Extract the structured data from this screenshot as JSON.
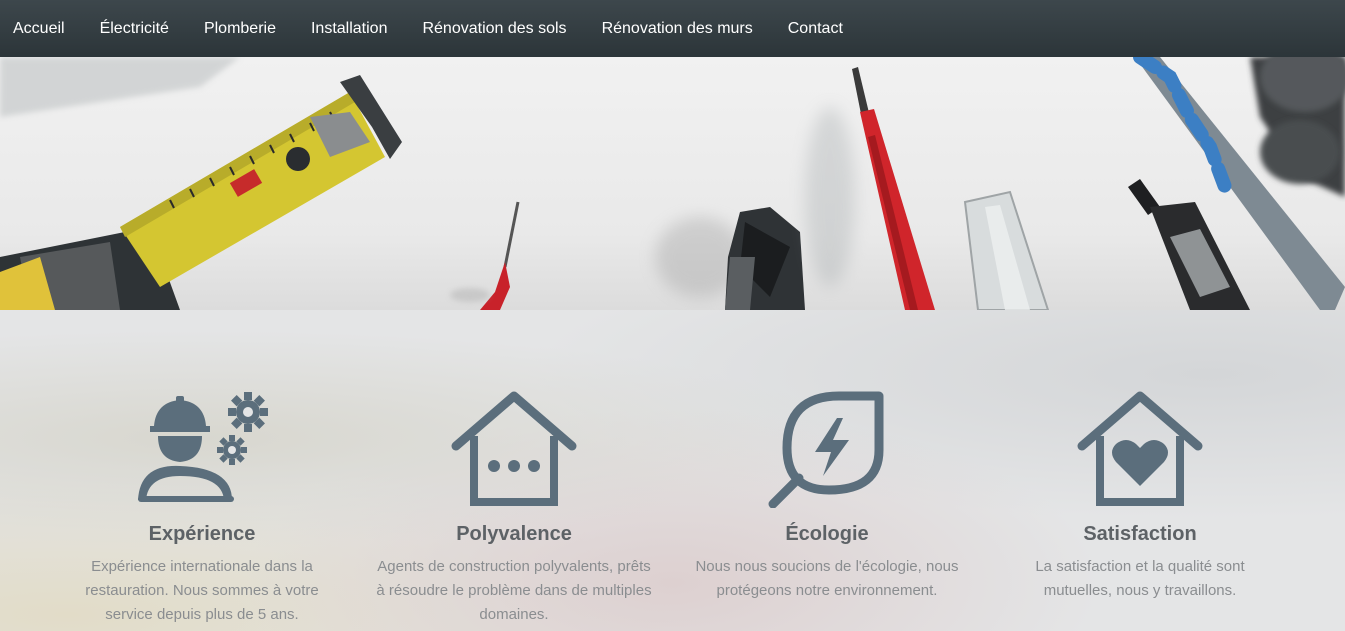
{
  "nav": {
    "items": [
      {
        "label": "Accueil"
      },
      {
        "label": "Électricité"
      },
      {
        "label": "Plomberie"
      },
      {
        "label": "Installation"
      },
      {
        "label": "Rénovation des sols"
      },
      {
        "label": "Rénovation des murs"
      },
      {
        "label": "Contact"
      }
    ]
  },
  "colors": {
    "nav_bg": "#2f383c",
    "icon": "#5b6e7c",
    "heading": "#5d6266",
    "text": "#8a8d90"
  },
  "features": [
    {
      "icon": "worker-gears-icon",
      "title": "Expérience",
      "text": "Expérience internationale dans la restauration. Nous sommes à votre service depuis plus de 5 ans."
    },
    {
      "icon": "house-dots-icon",
      "title": "Polyvalence",
      "text": "Agents de construction polyvalents, prêts à résoudre le problème dans de multiples domaines."
    },
    {
      "icon": "leaf-bolt-icon",
      "title": "Écologie",
      "text": "Nous nous soucions de l'écologie, nous protégeons notre environnement."
    },
    {
      "icon": "house-heart-icon",
      "title": "Satisfaction",
      "text": "La satisfaction et la qualité sont mutuelles, nous y travaillons."
    }
  ]
}
